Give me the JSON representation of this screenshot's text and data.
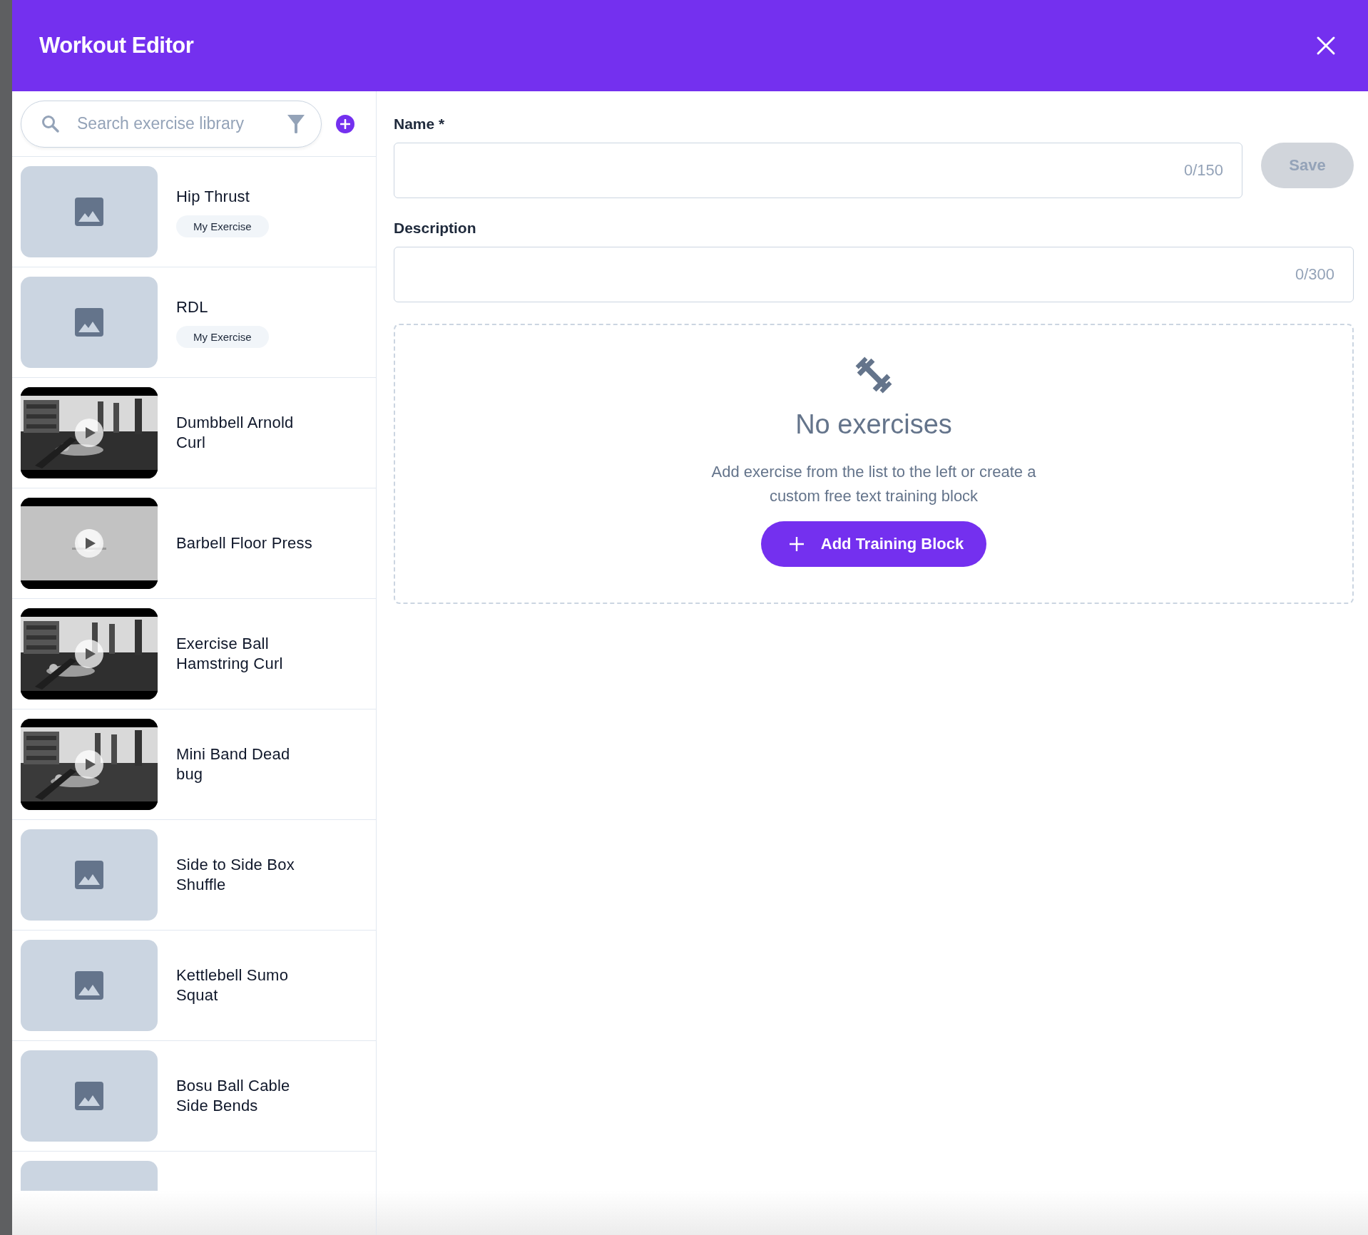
{
  "window": {
    "title": "Workout Editor"
  },
  "sidebar": {
    "search": {
      "placeholder": "Search exercise library"
    },
    "items": [
      {
        "name": "Hip Thrust",
        "badge": "My Exercise",
        "kind": "placeholder"
      },
      {
        "name": "RDL",
        "badge": "My Exercise",
        "kind": "placeholder"
      },
      {
        "name": "Dumbbell Arnold Curl",
        "kind": "video"
      },
      {
        "name": "Barbell Floor Press",
        "kind": "video"
      },
      {
        "name": "Exercise Ball Hamstring Curl",
        "kind": "video"
      },
      {
        "name": "Mini Band Dead bug",
        "kind": "video"
      },
      {
        "name": "Side to Side Box Shuffle",
        "kind": "placeholder"
      },
      {
        "name": "Kettlebell Sumo Squat",
        "kind": "placeholder"
      },
      {
        "name": "Bosu Ball Cable Side Bends",
        "kind": "placeholder"
      },
      {
        "kind": "placeholder"
      }
    ]
  },
  "form": {
    "name": {
      "label": "Name *",
      "counter": "0/150"
    },
    "save_button": {
      "label": "Save",
      "disabled": true
    },
    "description": {
      "label": "Description",
      "counter": "0/300"
    }
  },
  "empty_state": {
    "title": "No exercises",
    "message": "Add exercise from the list to the left or create a custom free text training block",
    "button": "Add Training Block"
  }
}
